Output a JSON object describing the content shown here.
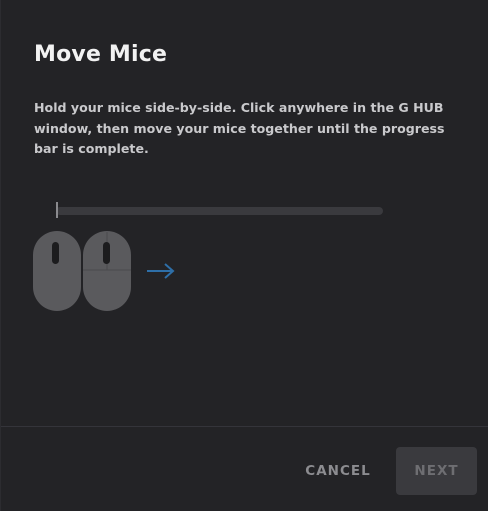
{
  "dialog": {
    "title": "Move Mice",
    "instructions": "Hold your mice side-by-side. Click anywhere in the G HUB window, then move your mice together until the progress bar is complete.",
    "progress": 0
  },
  "footer": {
    "cancel_label": "CANCEL",
    "next_label": "NEXT"
  },
  "colors": {
    "background": "#232326",
    "arrow": "#2e6fa8",
    "next_disabled_bg": "#3a3a3e"
  },
  "icons": {
    "arrow": "arrow-right-icon",
    "mouse": "mouse-icon"
  }
}
